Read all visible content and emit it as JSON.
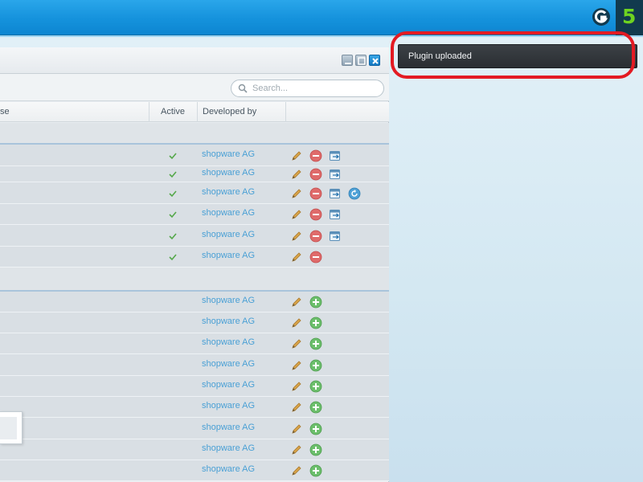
{
  "notification": {
    "message": "Plugin uploaded"
  },
  "search": {
    "placeholder": "Search..."
  },
  "columns": {
    "partial": "se",
    "active": "Active",
    "developer": "Developed by"
  },
  "window_controls": [
    "minimize",
    "maximize",
    "close"
  ],
  "colors": {
    "accent": "#1592dc",
    "link": "#4aa0d5",
    "highlight": "#e31b23",
    "logo_green": "#6ed320"
  },
  "logo": {
    "s": "shopware-icon",
    "five": "5"
  },
  "installed_plugins": [
    {
      "active": true,
      "developer": "shopware AG",
      "actions": [
        "edit-icon",
        "remove-icon",
        "config-icon"
      ]
    },
    {
      "active": true,
      "developer": "shopware AG",
      "actions": [
        "edit-icon",
        "remove-icon",
        "config-icon"
      ]
    },
    {
      "active": true,
      "developer": "shopware AG",
      "actions": [
        "edit-icon",
        "remove-icon",
        "config-icon",
        "reinstall-icon"
      ]
    },
    {
      "active": true,
      "developer": "shopware AG",
      "actions": [
        "edit-icon",
        "remove-icon",
        "config-icon"
      ]
    },
    {
      "active": true,
      "developer": "shopware AG",
      "actions": [
        "edit-icon",
        "remove-icon",
        "config-icon"
      ]
    },
    {
      "active": true,
      "developer": "shopware AG",
      "actions": [
        "edit-icon",
        "remove-icon"
      ]
    }
  ],
  "uninstalled_plugins": [
    {
      "developer": "shopware AG",
      "actions": [
        "edit-icon",
        "install-icon"
      ]
    },
    {
      "developer": "shopware AG",
      "actions": [
        "edit-icon",
        "install-icon"
      ]
    },
    {
      "developer": "shopware AG",
      "actions": [
        "edit-icon",
        "install-icon"
      ]
    },
    {
      "developer": "shopware AG",
      "actions": [
        "edit-icon",
        "install-icon"
      ]
    },
    {
      "developer": "shopware AG",
      "actions": [
        "edit-icon",
        "install-icon"
      ]
    },
    {
      "developer": "shopware AG",
      "actions": [
        "edit-icon",
        "install-icon"
      ]
    },
    {
      "developer": "shopware AG",
      "actions": [
        "edit-icon",
        "install-icon"
      ]
    },
    {
      "developer": "shopware AG",
      "actions": [
        "edit-icon",
        "install-icon"
      ]
    },
    {
      "developer": "shopware AG",
      "actions": [
        "edit-icon",
        "install-icon"
      ]
    }
  ]
}
